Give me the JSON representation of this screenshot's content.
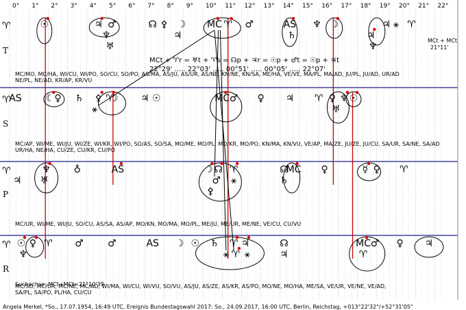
{
  "chart_data": {
    "type": "table",
    "x_ticks": [
      "0°",
      "1°",
      "2°",
      "3°",
      "4°",
      "5°",
      "6°",
      "7°",
      "8°",
      "9°",
      "10°",
      "11°",
      "12°",
      "13°",
      "14°",
      "15°",
      "16°",
      "17°",
      "18°",
      "19°",
      "20°",
      "21°",
      "22°"
    ],
    "x_range": [
      0,
      22.5
    ],
    "rows": [
      "T",
      "S",
      "P",
      "R"
    ],
    "row_signs": [
      "♈",
      "♈",
      "♈",
      "♈"
    ],
    "formula": "MCt + ♈r = ♅t + ♈s = ☊p + ♃r = ☉p + ♂t = ☉p + ♃t",
    "formula_values": "22°29' ….. 22°03' ….. 00°51' ….. 00°05' ….. 22°07'",
    "mc_note": "MCt + MCt",
    "mc_note_value": "21°11'",
    "search_line": "Suchachse: MCt+MCt=21°10'39",
    "footer": "Angela Merkel, *So., 17.07.1954, 16:49 UTC, Ereignis Bundestagswahl 2017: So., 24.09.2017, 16:00 UTC, Berlin, Reichstag, +013°22'32\"/+52°31'05\"",
    "pair_lines": {
      "T": [
        "MC/MO, MC/HA, WI/CU, WI/PO, SO/CU, SO/PO, AS/MA, AS/JU, AS/UR, AS/NE, KN/NE, KN/SA, ME/HA, VE/VE, MA/PL, MA/AD, JU/PL, JU/AD, UR/AD",
        "NE/PL, NE/AD, KR/AP, KR/VU"
      ],
      "S": [
        "MC/AP, WI/ME, WI/JU, WI/ZE, WI/KR, WI/PO, SO/AS, SO/SA, MO/ME, MO/PL, MO/KR, MO/PO, KN/MA, KN/VU, VE/AP, MA/ZE, JU/ZE, JU/CU, SA/UR, SA/NE, SA/AD",
        "UR/HA, NE/HA, CU/ZE, CU/KR, CU/PO"
      ],
      "P": [
        "MC/UR, WI/ME, WI/JU, SO/CU, AS/SA, AS/AP, MO/KN, MO/MA, MO/PL, ME/JU, ME/UR, ME/NE, VE/CU, CU/VU"
      ],
      "R": [
        "MC/SO, MC/UR, MC/NE, MC/AD, WI/MA, WI/CU, WI/VU, SO/VU, AS/JU, AS/ZE, AS/KR, AS/PO, MO/NE, MO/HA, ME/SA, VE/UR, VE/NE, VE/AD,",
        "SA/PL, SA/PO, PL/HA, CU/CU"
      ]
    },
    "symbols": [
      {
        "row": "T",
        "deg": 1.8,
        "g": "☉",
        "red": true
      },
      {
        "row": "T",
        "deg": 4.6,
        "g": "♃",
        "red": true
      },
      {
        "row": "T",
        "deg": 5.3,
        "g": "♂",
        "red": false
      },
      {
        "row": "T",
        "deg": 5.0,
        "g": "♆",
        "red": false,
        "sub": 1
      },
      {
        "row": "T",
        "deg": 5.2,
        "g": "♅",
        "red": false,
        "sub": 2
      },
      {
        "row": "T",
        "deg": 7.4,
        "g": "☊",
        "red": false
      },
      {
        "row": "T",
        "deg": 8.0,
        "g": "⚴",
        "red": false
      },
      {
        "row": "T",
        "deg": 8.9,
        "g": "☽",
        "red": false
      },
      {
        "row": "T",
        "deg": 8.7,
        "g": "♃",
        "red": false,
        "sub": 1
      },
      {
        "row": "T",
        "deg": 10.6,
        "g": "MC",
        "red": true
      },
      {
        "row": "T",
        "deg": 11.3,
        "g": "♈",
        "red": true
      },
      {
        "row": "T",
        "deg": 12.4,
        "g": "♂",
        "red": false
      },
      {
        "row": "T",
        "deg": 14.5,
        "g": "AS",
        "red": true
      },
      {
        "row": "T",
        "deg": 14.6,
        "g": "♄",
        "red": false,
        "sub": 1
      },
      {
        "row": "T",
        "deg": 15.9,
        "g": "♆",
        "red": false
      },
      {
        "row": "T",
        "deg": 16.8,
        "g": "☽",
        "red": true
      },
      {
        "row": "T",
        "deg": 18.7,
        "g": "♃",
        "red": true,
        "sub": 1
      },
      {
        "row": "T",
        "deg": 18.8,
        "g": "♆",
        "red": false,
        "sub": 2
      },
      {
        "row": "T",
        "deg": 19.5,
        "g": "♃",
        "red": false
      },
      {
        "row": "T",
        "deg": 20.0,
        "g": "⚹",
        "red": false
      },
      {
        "row": "T",
        "deg": 20.8,
        "g": "♈",
        "red": false
      },
      {
        "row": "S",
        "deg": 0.3,
        "g": "AS",
        "red": false
      },
      {
        "row": "S",
        "deg": 2.1,
        "g": "☾",
        "red": true
      },
      {
        "row": "S",
        "deg": 2.5,
        "g": "♀",
        "red": false
      },
      {
        "row": "S",
        "deg": 3.6,
        "g": "♄",
        "red": false
      },
      {
        "row": "S",
        "deg": 4.6,
        "g": "⚴",
        "red": true
      },
      {
        "row": "S",
        "deg": 5.2,
        "g": "♈",
        "red": true
      },
      {
        "row": "S",
        "deg": 5.4,
        "g": "☽",
        "red": false
      },
      {
        "row": "S",
        "deg": 4.4,
        "g": "⚹",
        "red": false,
        "sub": 1
      },
      {
        "row": "S",
        "deg": 7.0,
        "g": "♃",
        "red": false
      },
      {
        "row": "S",
        "deg": 7.6,
        "g": "☉",
        "red": false
      },
      {
        "row": "S",
        "deg": 11.0,
        "g": "MC",
        "red": true
      },
      {
        "row": "S",
        "deg": 11.6,
        "g": "♂",
        "red": false
      },
      {
        "row": "S",
        "deg": 13.0,
        "g": "♀",
        "red": false
      },
      {
        "row": "S",
        "deg": 14.5,
        "g": "♃",
        "red": false
      },
      {
        "row": "S",
        "deg": 16.0,
        "g": "♈",
        "red": false
      },
      {
        "row": "S",
        "deg": 16.7,
        "g": "♀",
        "red": false
      },
      {
        "row": "S",
        "deg": 17.3,
        "g": "♆",
        "red": true
      },
      {
        "row": "S",
        "deg": 17.8,
        "g": "☉",
        "red": true
      },
      {
        "row": "S",
        "deg": 16.9,
        "g": "♅",
        "red": false,
        "sub": 1
      },
      {
        "row": "P",
        "deg": 0.4,
        "g": "♃",
        "red": false,
        "sub": 1
      },
      {
        "row": "P",
        "deg": 1.9,
        "g": "♆",
        "red": true
      },
      {
        "row": "P",
        "deg": 1.8,
        "g": "♅",
        "red": false,
        "sub": 1
      },
      {
        "row": "P",
        "deg": 3.5,
        "g": "♁",
        "red": false
      },
      {
        "row": "P",
        "deg": 5.6,
        "g": "AS",
        "red": true
      },
      {
        "row": "P",
        "deg": 10.3,
        "g": "☽",
        "red": true
      },
      {
        "row": "P",
        "deg": 10.8,
        "g": "☊",
        "red": true
      },
      {
        "row": "P",
        "deg": 11.6,
        "g": "♈",
        "red": true
      },
      {
        "row": "P",
        "deg": 10.7,
        "g": "♂",
        "red": false,
        "sub": 1
      },
      {
        "row": "P",
        "deg": 11.6,
        "g": "⚹",
        "red": false,
        "sub": 1
      },
      {
        "row": "P",
        "deg": 10.4,
        "g": "⚴",
        "red": false,
        "sub": 2
      },
      {
        "row": "P",
        "deg": 14.2,
        "g": "☊",
        "red": false
      },
      {
        "row": "P",
        "deg": 14.7,
        "g": "MC",
        "red": true
      },
      {
        "row": "P",
        "deg": 14.2,
        "g": "♄",
        "red": false,
        "sub": 1
      },
      {
        "row": "P",
        "deg": 16.3,
        "g": "♀",
        "red": false
      },
      {
        "row": "P",
        "deg": 18.4,
        "g": "☿",
        "red": true
      },
      {
        "row": "P",
        "deg": 19.0,
        "g": "♀",
        "red": false
      },
      {
        "row": "P",
        "deg": 20.4,
        "g": "♈",
        "red": false
      },
      {
        "row": "R",
        "deg": 0.6,
        "g": "☉",
        "red": true
      },
      {
        "row": "R",
        "deg": 1.2,
        "g": "♀",
        "red": true
      },
      {
        "row": "R",
        "deg": 0.7,
        "g": "♆",
        "red": false,
        "sub": 1
      },
      {
        "row": "R",
        "deg": 2.0,
        "g": "♈",
        "red": false
      },
      {
        "row": "R",
        "deg": 3.6,
        "g": "♂",
        "red": false
      },
      {
        "row": "R",
        "deg": 5.3,
        "g": "♂",
        "red": false
      },
      {
        "row": "R",
        "deg": 7.4,
        "g": "AS",
        "red": false
      },
      {
        "row": "R",
        "deg": 8.8,
        "g": "☽",
        "red": false
      },
      {
        "row": "R",
        "deg": 9.6,
        "g": "☉",
        "red": false
      },
      {
        "row": "R",
        "deg": 10.6,
        "g": "♄",
        "red": false
      },
      {
        "row": "R",
        "deg": 11.6,
        "g": "♈",
        "red": true
      },
      {
        "row": "R",
        "deg": 12.2,
        "g": "♃",
        "red": true
      },
      {
        "row": "R",
        "deg": 11.2,
        "g": "⚹",
        "red": false,
        "sub": 1
      },
      {
        "row": "R",
        "deg": 11.7,
        "g": "♈",
        "red": true,
        "sub": 1
      },
      {
        "row": "R",
        "deg": 12.3,
        "g": "⚹",
        "red": false,
        "sub": 1
      },
      {
        "row": "R",
        "deg": 14.2,
        "g": "☊",
        "red": false
      },
      {
        "row": "R",
        "deg": 14.2,
        "g": "♃",
        "red": false,
        "sub": 1
      },
      {
        "row": "R",
        "deg": 18.3,
        "g": "MC",
        "red": true
      },
      {
        "row": "R",
        "deg": 18.9,
        "g": "♂",
        "red": false
      },
      {
        "row": "R",
        "deg": 18.3,
        "g": "♈",
        "red": false,
        "sub": 1
      },
      {
        "row": "R",
        "deg": 20.2,
        "g": "♀",
        "red": false
      },
      {
        "row": "R",
        "deg": 21.7,
        "g": "♃",
        "red": false
      }
    ],
    "ellipse_groups": [
      {
        "row": "T",
        "deg": 1.8,
        "w": 22,
        "h": 38
      },
      {
        "row": "T",
        "deg": 4.9,
        "w": 44,
        "h": 28
      },
      {
        "row": "T",
        "deg": 11.0,
        "w": 54,
        "h": 30
      },
      {
        "row": "T",
        "deg": 14.5,
        "w": 22,
        "h": 42
      },
      {
        "row": "T",
        "deg": 16.8,
        "w": 24,
        "h": 30
      },
      {
        "row": "T",
        "deg": 19.0,
        "w": 24,
        "h": 40
      },
      {
        "row": "S",
        "deg": 2.3,
        "w": 30,
        "h": 22
      },
      {
        "row": "S",
        "deg": 5.3,
        "w": 40,
        "h": 34
      },
      {
        "row": "S",
        "deg": 11.2,
        "w": 46,
        "h": 44
      },
      {
        "row": "S",
        "deg": 17.0,
        "w": 32,
        "h": 46
      },
      {
        "row": "S",
        "deg": 17.8,
        "w": 22,
        "h": 22
      },
      {
        "row": "P",
        "deg": 1.9,
        "w": 34,
        "h": 44
      },
      {
        "row": "P",
        "deg": 10.9,
        "w": 62,
        "h": 56
      },
      {
        "row": "P",
        "deg": 14.6,
        "w": 24,
        "h": 44
      },
      {
        "row": "P",
        "deg": 18.6,
        "w": 34,
        "h": 26
      },
      {
        "row": "R",
        "deg": 1.3,
        "w": 26,
        "h": 30
      },
      {
        "row": "R",
        "deg": 11.4,
        "w": 100,
        "h": 48
      },
      {
        "row": "R",
        "deg": 18.5,
        "w": 52,
        "h": 50
      },
      {
        "row": "R",
        "deg": 21.7,
        "w": 42,
        "h": 30
      }
    ],
    "red_lines": [
      {
        "deg": 1.85,
        "from": "T",
        "to": "R"
      },
      {
        "deg": 5.35,
        "from": "S",
        "to": "P"
      },
      {
        "deg": 11.3,
        "from": "T",
        "to": "R"
      },
      {
        "deg": 16.75,
        "from": "T",
        "to": "P"
      },
      {
        "deg": 17.75,
        "from": "S",
        "to": "R"
      }
    ],
    "connectors": [
      {
        "a": {
          "row": "T",
          "deg": 10.6
        },
        "b": {
          "row": "S",
          "deg": 4.6
        }
      },
      {
        "a": {
          "row": "T",
          "deg": 10.6
        },
        "b": {
          "row": "R",
          "deg": 11.6
        }
      },
      {
        "a": {
          "row": "T",
          "deg": 10.9
        },
        "b": {
          "row": "R",
          "deg": 11.2
        }
      },
      {
        "a": {
          "row": "T",
          "deg": 10.8
        },
        "b": {
          "row": "P",
          "deg": 10.6
        }
      }
    ]
  }
}
